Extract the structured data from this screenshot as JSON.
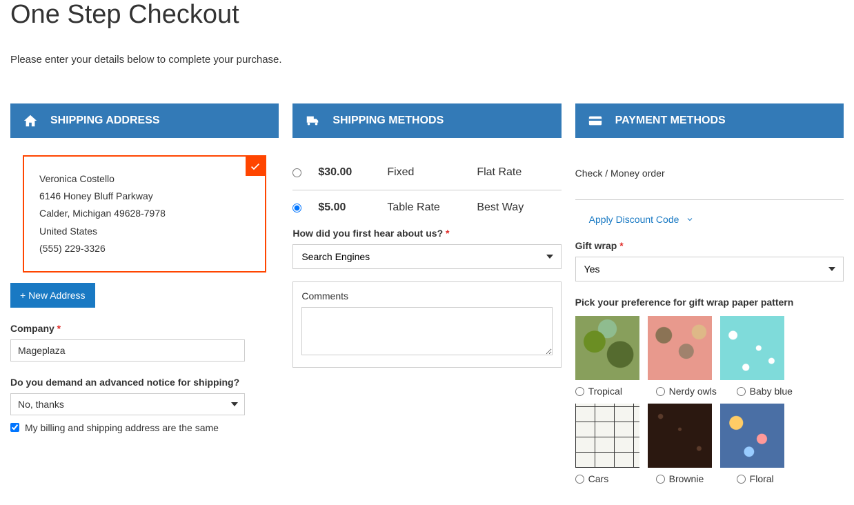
{
  "page": {
    "title": "One Step Checkout",
    "subtitle": "Please enter your details below to complete your purchase."
  },
  "shipping_address": {
    "header": "SHIPPING ADDRESS",
    "card": {
      "name": "Veronica Costello",
      "street": "6146 Honey Bluff Parkway",
      "city_line": "Calder, Michigan 49628-7978",
      "country": "United States",
      "phone": "(555) 229-3326"
    },
    "new_button": "+ New Address",
    "company_label": "Company",
    "company_value": "Mageplaza",
    "notice_label": "Do you demand an advanced notice for shipping?",
    "notice_value": "No, thanks",
    "same_billing_label": "My billing and shipping address are the same"
  },
  "shipping_methods": {
    "header": "SHIPPING METHODS",
    "options": [
      {
        "price": "$30.00",
        "type": "Fixed",
        "name": "Flat Rate",
        "selected": false
      },
      {
        "price": "$5.00",
        "type": "Table Rate",
        "name": "Best Way",
        "selected": true
      }
    ],
    "hear_label": "How did you first hear about us?",
    "hear_value": "Search Engines",
    "comments_label": "Comments"
  },
  "payment_methods": {
    "header": "PAYMENT METHODS",
    "method": "Check / Money order",
    "discount_label": "Apply Discount Code",
    "giftwrap_label": "Gift wrap",
    "giftwrap_value": "Yes",
    "pattern_label": "Pick your preference for gift wrap paper pattern",
    "patterns_row1": [
      "Tropical",
      "Nerdy owls",
      "Baby blue"
    ],
    "patterns_row2": [
      "Cars",
      "Brownie",
      "Floral"
    ]
  }
}
